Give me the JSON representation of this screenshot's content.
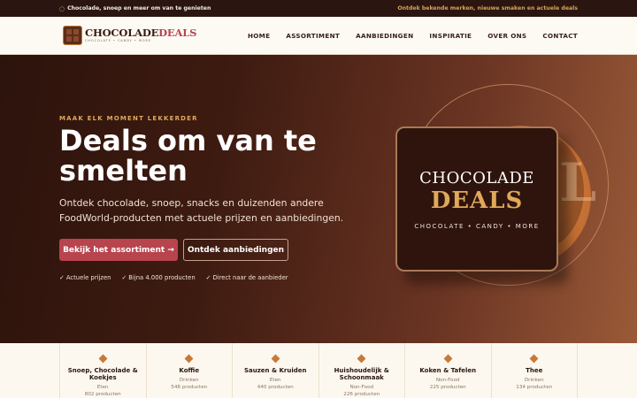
{
  "topbar": {
    "left_text": "Chocolade, snoep en meer om van te genieten",
    "right_text": "Ontdek bekende merken, nieuwe smaken en actuele deals"
  },
  "logo": {
    "main_a": "CHOCOLADE",
    "main_b": "DEALS",
    "sub": "CHOCOLATE • CANDY • MORE"
  },
  "nav": [
    "HOME",
    "ASSORTIMENT",
    "AANBIEDINGEN",
    "INSPIRATIE",
    "OVER ONS",
    "CONTACT"
  ],
  "hero": {
    "tag": "MAAK ELK MOMENT LEKKERDER",
    "title": "Deals om van te smelten",
    "description": "Ontdek chocolade, snoep, snacks en duizenden andere FoodWorld-producten met actuele prijzen en aanbiedingen.",
    "primary_button": "Bekijk het assortiment →",
    "secondary_button": "Ontdek aanbiedingen",
    "checks": [
      "✓ Actuele prijzen",
      "✓ Bijna 4.000 producten",
      "✓ Direct naar de aanbieder"
    ]
  },
  "hero_card": {
    "line1": "CHOCOLADE",
    "line2": "DEALS",
    "line3": "CHOCOLATE • CANDY • MORE",
    "ghost_letter": "L"
  },
  "categories": [
    {
      "name": "Snoep, Chocolade & Koekjes",
      "type": "Eten",
      "count": "802 producten"
    },
    {
      "name": "Koffie",
      "type": "Drinken",
      "count": "548 producten"
    },
    {
      "name": "Sauzen & Kruiden",
      "type": "Eten",
      "count": "440 producten"
    },
    {
      "name": "Huishoudelijk & Schoonmaak",
      "type": "Non-Food",
      "count": "226 producten"
    },
    {
      "name": "Koken & Tafelen",
      "type": "Non-Food",
      "count": "225 producten"
    },
    {
      "name": "Thee",
      "type": "Drinken",
      "count": "134 producten"
    }
  ],
  "icons": {
    "topbar": "circle-icon",
    "category": "diamond-icon"
  },
  "colors": {
    "accent": "#b8444e",
    "gold": "#e0a85a",
    "dark": "#2a1510"
  }
}
